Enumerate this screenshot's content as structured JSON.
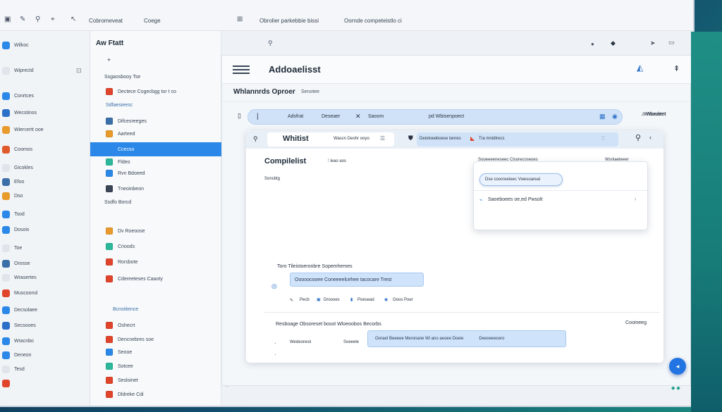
{
  "topbar": {
    "label_a": "Cobromeveat",
    "label_b": "Coege",
    "label_c": "Obrolier parkebbie bissi",
    "label_d": "Oornde competeistlo ci"
  },
  "sidebar_left": {
    "items": [
      {
        "label": "Wilkoc",
        "color": "#2b88e8"
      },
      {
        "label": "Wiprectd",
        "color": "#e0e5ec",
        "badge": "⊡"
      },
      {
        "label": "Conrtces",
        "color": "#2b88e8"
      },
      {
        "label": "Wecstinos",
        "color": "#2b6fc8"
      },
      {
        "label": "Wiercertt ooe",
        "color": "#e89a2b"
      },
      {
        "label": "Coomos",
        "color": "#e05a2b"
      },
      {
        "label": "Gicokles",
        "color": "#e0e5ec"
      },
      {
        "label": "Efoo",
        "color": "#3a6fa8"
      },
      {
        "label": "Dso",
        "color": "#e89a2b"
      },
      {
        "label": "Tsod",
        "color": "#2b88e8"
      },
      {
        "label": "Dosois",
        "color": "#2b88e8"
      },
      {
        "label": "Toe",
        "color": "#e0e5ec"
      },
      {
        "label": "Orosse",
        "color": "#3a6fa8"
      },
      {
        "label": "Wrasertes",
        "color": "#e0e5ec"
      },
      {
        "label": "Muscoonsl",
        "color": "#e0442b"
      },
      {
        "label": "Decsolaee",
        "color": "#2b88e8"
      },
      {
        "label": "Secsooes",
        "color": "#2b6fc8"
      },
      {
        "label": "Wracnbo",
        "color": "#2b88e8"
      },
      {
        "label": "Deneon",
        "color": "#2b88e8"
      },
      {
        "label": "Tesd",
        "color": "#e0e5ec"
      },
      {
        "label": "",
        "color": "#e0442b"
      }
    ]
  },
  "sidebar_mid": {
    "title": "Aw Ftatt",
    "section_a": "Ssgaosbooy  Tse",
    "section_b": "Sdfaesieesc",
    "section_c": "Ssdfo Borcd",
    "section_d": "Bcnstitence",
    "items": [
      {
        "label": "Dectece Cogecbgg tor t co",
        "color": "#e0442b"
      },
      {
        "label": "Difcesreeges",
        "color": "#3a6fa8"
      },
      {
        "label": "Aarteed",
        "color": "#e89a2b"
      },
      {
        "label": "Ccecso",
        "color": "#ffffff",
        "active": true
      },
      {
        "label": "Fldeo",
        "color": "#2bb89a"
      },
      {
        "label": "Rvn Bdoeed",
        "color": "#2b88e8"
      },
      {
        "label": "Tneoinbeon",
        "color": "#3a4656"
      },
      {
        "label": "Dv Roeoose",
        "color": "#e89a2b"
      },
      {
        "label": "Crioods",
        "color": "#2bb89a"
      },
      {
        "label": "Rorsbote",
        "color": "#e0442b"
      },
      {
        "label": "Cdereeteses Caaoty",
        "color": "#e0442b"
      },
      {
        "label": "Oshecrt",
        "color": "#e0442b"
      },
      {
        "label": "Dencnebres soe",
        "color": "#e0442b"
      },
      {
        "label": "Seooe",
        "color": "#2b88e8"
      },
      {
        "label": "Sotcee",
        "color": "#2bb89a"
      },
      {
        "label": "Sesloinet",
        "color": "#e0442b"
      },
      {
        "label": "Dldreke Cdi",
        "color": "#e0442b"
      }
    ]
  },
  "main": {
    "title": "Addoaelisst",
    "subtitle": "Whlannrds Oproer",
    "subtitle_meta": "Senotee",
    "toolbar": {
      "a": "Adsfrat",
      "b": "Deseaer",
      "c": "Saoom",
      "d": "pd Wbisenpoect"
    },
    "side_label": "Wbedeet",
    "card": {
      "tab_title": "Whitist",
      "tab_meta": "Wascn Deohr ooyo",
      "tab_b": "Deiotoeeboese tenres",
      "tab_c": "Tra mnidtrecs",
      "heading": "Compilelist",
      "heading_meta": "leao aos",
      "small_label": "Sonsbtg",
      "row1_label": "Toro Tileistoeronbre Sopemhemes",
      "input1": "Ooooocooee Coneeeelcehee tacocare Trest",
      "chips": [
        "Pecb",
        "Droooes",
        "Poesead",
        "Ooos Poer"
      ],
      "row2_label": "Resboage Obsoreset bosot  Wloeoobos Becorbs",
      "row2_right": "Cooineeg",
      "row3_a": "Wedeoneoi",
      "row3_b": "Soeeele",
      "input2": "Ooraet Beeeee Meronane Wi ano aeoee Doeie",
      "input2_tail": "Deeoeeecero"
    },
    "popup": {
      "header": "Sooeeeeneseec  Clsorecoseoes",
      "header_right": "Wsnlaeteeer",
      "field": "Dse coocreeteec Vwesoareal",
      "item": "Saoeboees oe,ed Pwsolt"
    },
    "header_right_label": "Wtsouotet"
  }
}
